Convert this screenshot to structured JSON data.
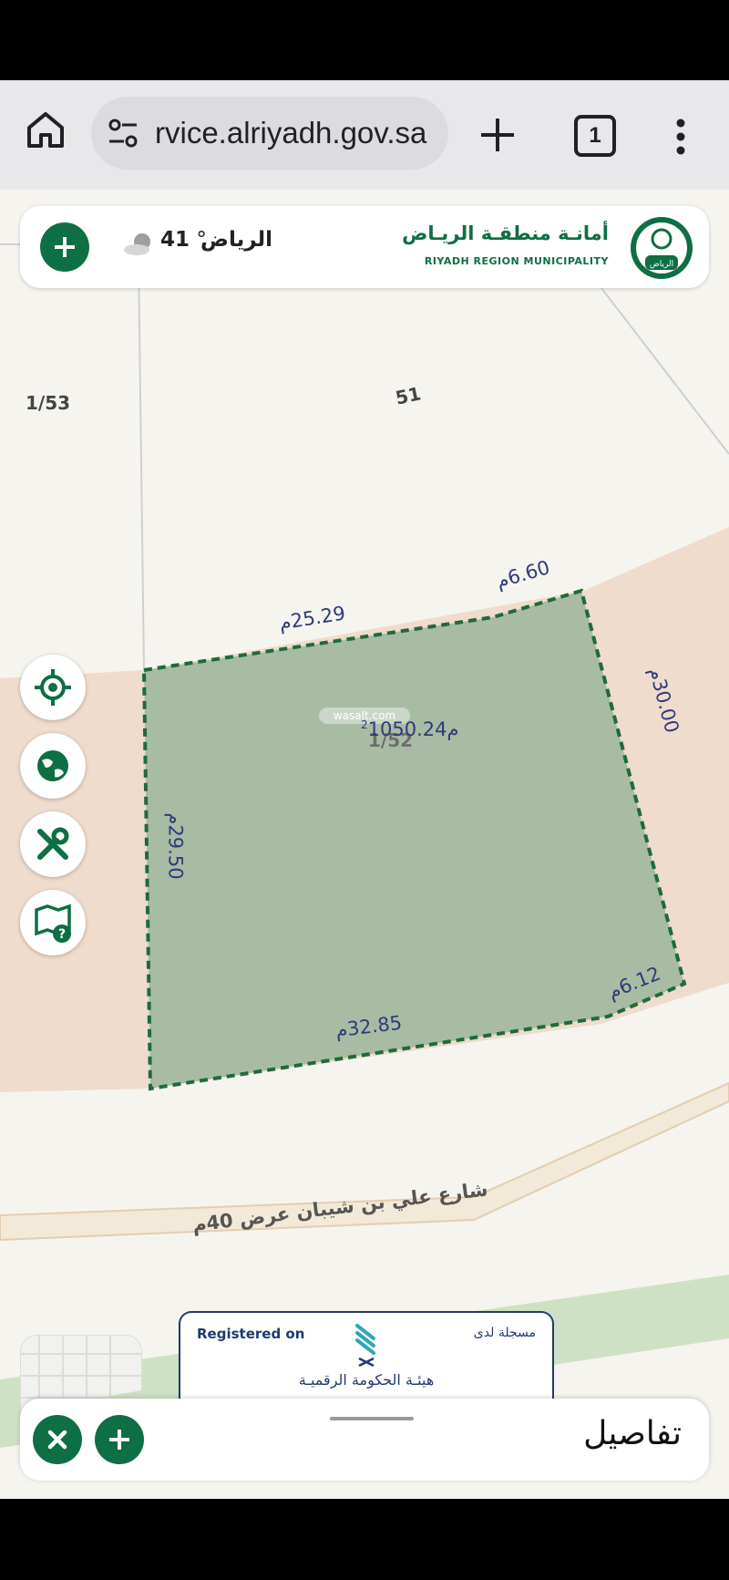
{
  "browser": {
    "url": "rvice.alriyadh.gov.sa",
    "tab_count": "1"
  },
  "header": {
    "city": "الرياض",
    "temperature": "41",
    "degree": "°",
    "logo_ar": "أمانـة منطقـة الريـاض",
    "logo_en": "RIYADH REGION MUNICIPALITY",
    "emblem_text": "الرياض"
  },
  "map": {
    "parcel_labels": {
      "parcel_left": "1/53",
      "parcel_top": "51",
      "parcel_selected_number": "1/52",
      "area": "1050.24",
      "area_unit": "م",
      "area_exp": "2"
    },
    "dimensions": {
      "top_left": "25.29م",
      "top_right": "6.60م",
      "right": "30.00م",
      "bottom_right": "6.12م",
      "bottom": "32.85م",
      "left": "29.50م"
    },
    "street_name": "شارع علي بن شيبان عرض 40م",
    "watermark": "wasalt.com",
    "colors": {
      "parcel_fill": "#a8bca3",
      "parcel_border": "#1e6b3a",
      "road": "#efdccd",
      "street": "#f3e9d8",
      "green_strip": "#cfe1c4",
      "brand_green": "#0e6e44"
    }
  },
  "side_tools": [
    {
      "name": "locate-icon"
    },
    {
      "name": "globe-icon"
    },
    {
      "name": "tools-icon"
    },
    {
      "name": "map-help-icon"
    }
  ],
  "registration": {
    "en": "Registered on",
    "ar": "مسجلة لدى",
    "gov": "هيئـة الحكومة الرقميـة"
  },
  "details": {
    "title": "تفاصيل"
  }
}
